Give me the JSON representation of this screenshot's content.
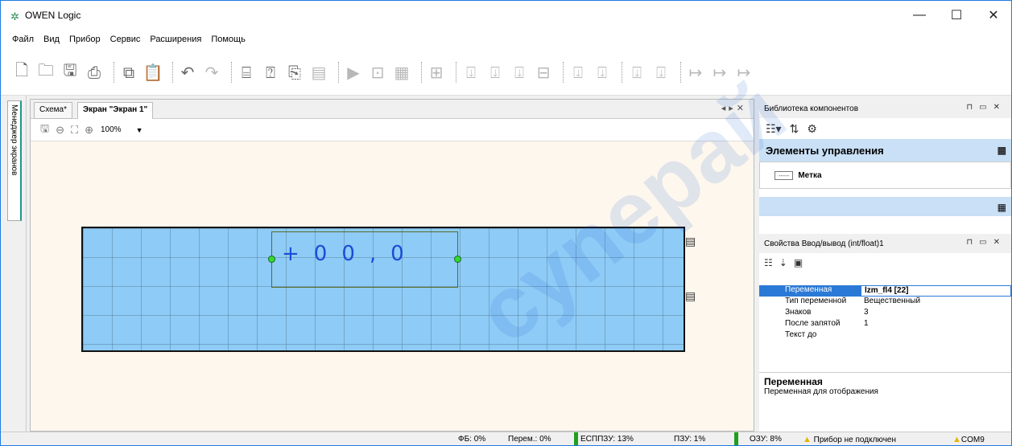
{
  "app": {
    "title": "OWEN Logic"
  },
  "window_controls": {
    "minimize": "—",
    "maximize": "☐",
    "close": "✕"
  },
  "menu": [
    "Файл",
    "Вид",
    "Прибор",
    "Сервис",
    "Расширения",
    "Помощь"
  ],
  "toolbar_icons": [
    "new-file-icon",
    "open-file-icon",
    "save-icon",
    "print-icon",
    "copy-icon",
    "paste-icon",
    "undo-icon",
    "redo-icon",
    "device-icon",
    "read-icon",
    "write-icon",
    "screen-icon",
    "run-icon",
    "add-block-icon",
    "table-icon",
    "text-block-icon",
    "v-connector-icon",
    "v-port-icon",
    "c-connector-icon",
    "c-port-icon",
    "n-connector-icon",
    "n-port-icon",
    "w-connector-icon",
    "r-connector-icon",
    "b-transfer-icon",
    "i-transfer-icon",
    "f-transfer-icon"
  ],
  "left_tab": {
    "label": "Менеджер экранов"
  },
  "doc_tabs": [
    {
      "label": "Схема*"
    },
    {
      "label": "Экран \"Экран 1\""
    }
  ],
  "editor": {
    "zoom": "100%",
    "field_text": "+00,0"
  },
  "library": {
    "title": "Библиотека компонентов",
    "category": "Элементы управления",
    "item_tag": "-----",
    "item": "Метка"
  },
  "properties": {
    "title": "Свойства Ввод/вывод (int/float)1",
    "rows": [
      {
        "key": "Переменная",
        "value": "lzm_fl4 [22]"
      },
      {
        "key": "Тип переменной",
        "value": "Вещественный"
      },
      {
        "key": "Знаков",
        "value": "3"
      },
      {
        "key": "После запятой",
        "value": "1"
      },
      {
        "key": "Текст до",
        "value": ""
      }
    ],
    "desc_title": "Переменная",
    "desc_text": "Переменная для отображения"
  },
  "status": {
    "fb": "ФБ: 0%",
    "per": "Перем.: 0%",
    "espzu": "ЕСППЗУ: 13%",
    "pzu": "ПЗУ: 1%",
    "ozu": "ОЗУ: 8%",
    "device": "Прибор не подключен",
    "port": "COM9"
  },
  "watermark": "cynepaй"
}
